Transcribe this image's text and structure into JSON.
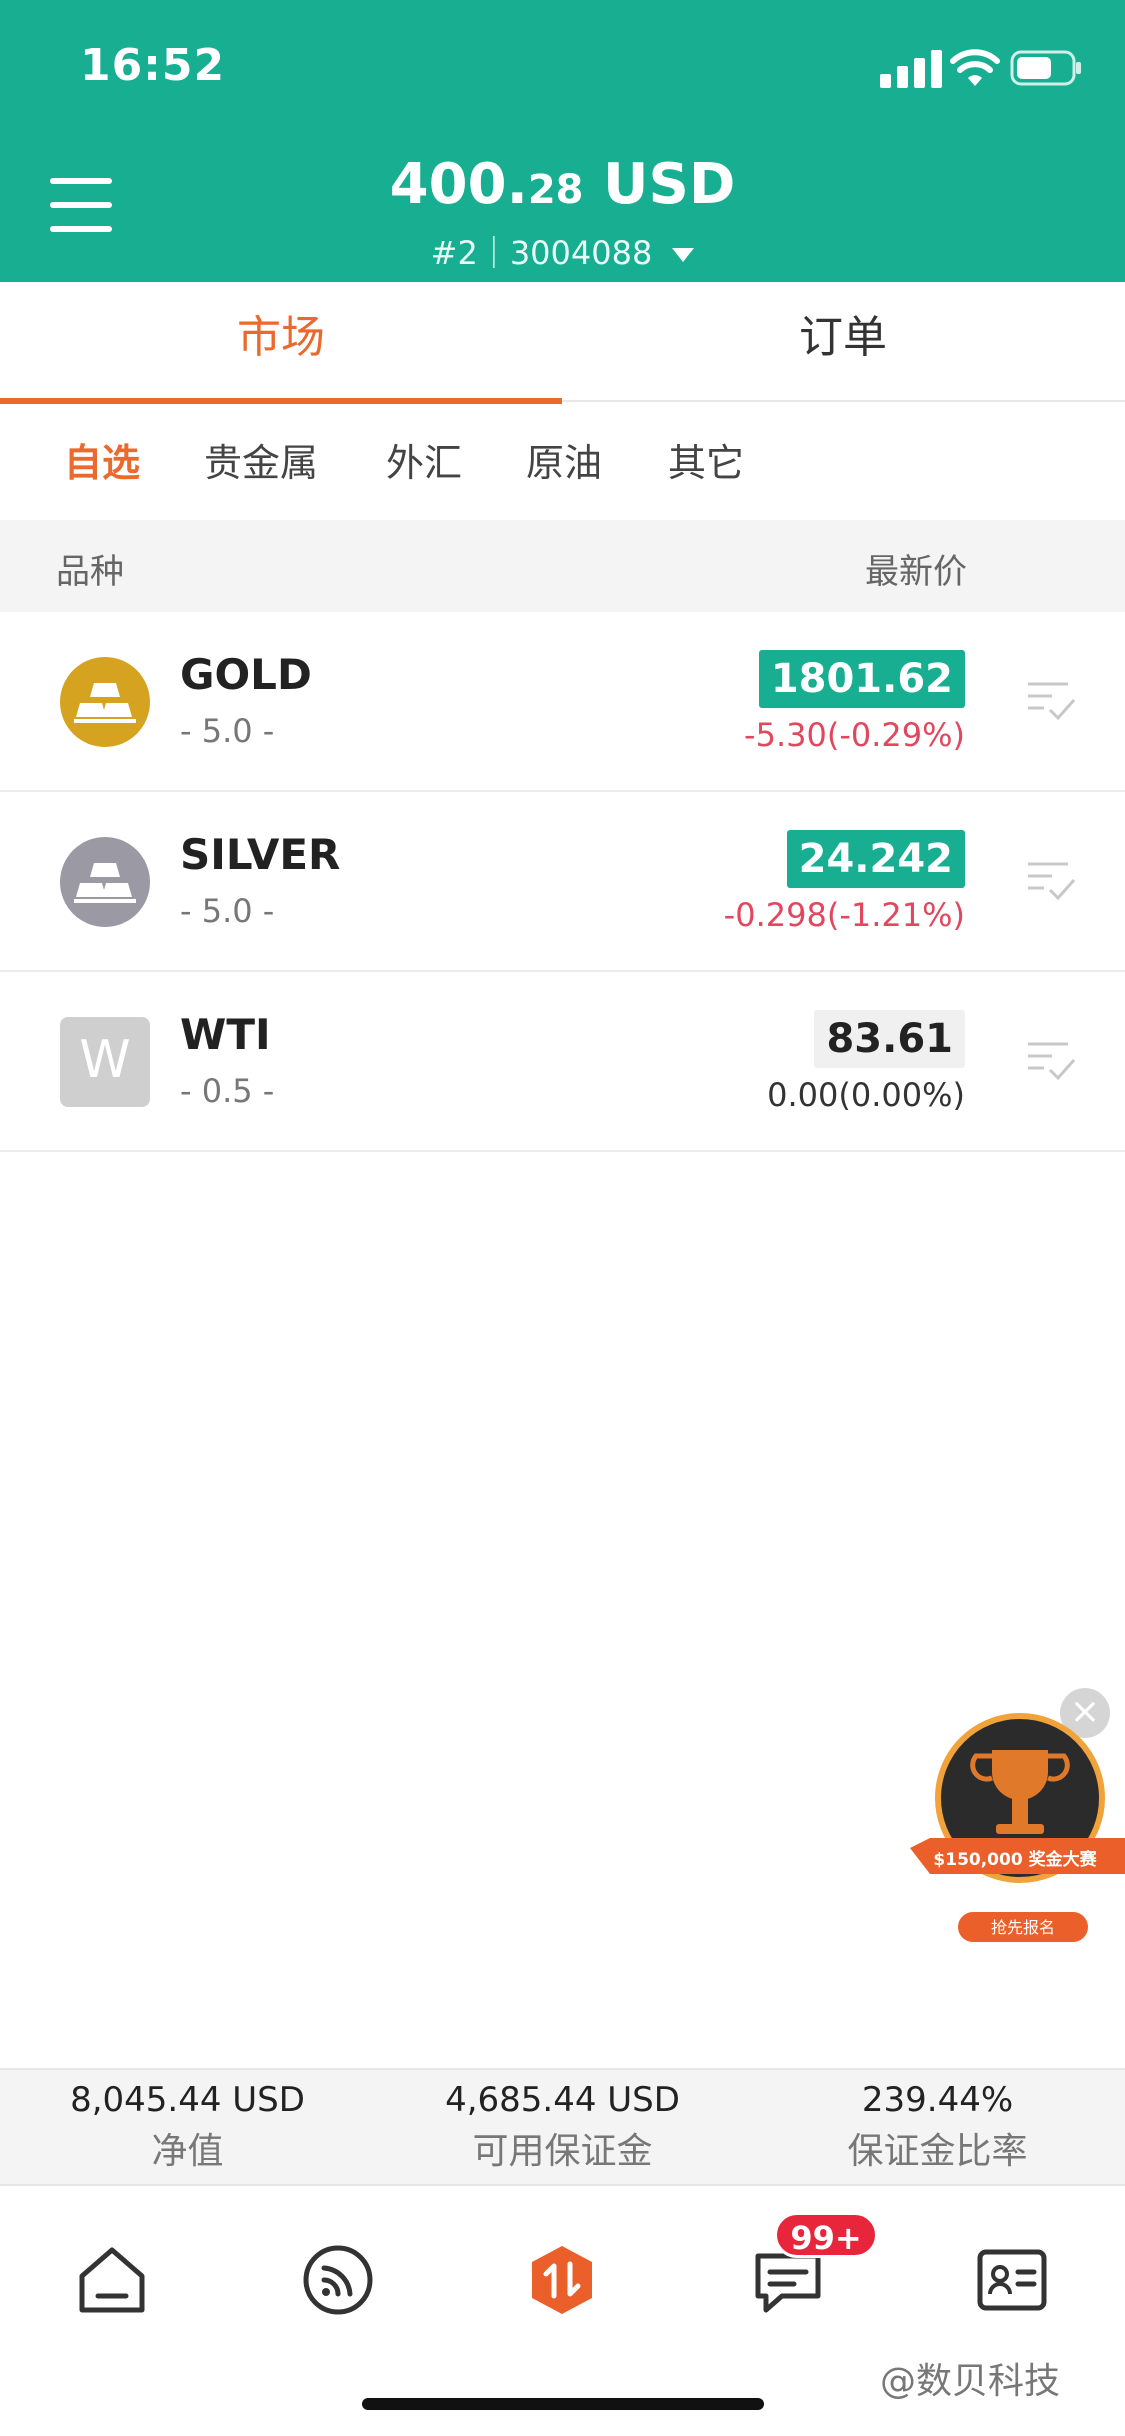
{
  "status_bar": {
    "time": "16:52"
  },
  "header": {
    "balance_int": "400.",
    "balance_dec": "28",
    "currency": "USD",
    "account": "#2｜3004088"
  },
  "main_tabs": [
    {
      "label": "市场",
      "active": true
    },
    {
      "label": "订单",
      "active": false
    }
  ],
  "sub_tabs": [
    {
      "label": "自选",
      "active": true
    },
    {
      "label": "贵金属"
    },
    {
      "label": "外汇"
    },
    {
      "label": "原油"
    },
    {
      "label": "其它"
    }
  ],
  "columns": {
    "symbol": "品种",
    "price": "最新价"
  },
  "instruments": [
    {
      "symbol": "GOLD",
      "lot": "- 5.0 -",
      "price": "1801.62",
      "change": "-5.30(-0.29%)",
      "icon": "gold-bars-icon"
    },
    {
      "symbol": "SILVER",
      "lot": "- 5.0 -",
      "price": "24.242",
      "change": "-0.298(-1.21%)",
      "icon": "silver-bars-icon"
    },
    {
      "symbol": "WTI",
      "lot": "- 0.5 -",
      "price": "83.61",
      "change": "0.00(0.00%)",
      "icon_letter": "W"
    }
  ],
  "promo": {
    "amount": "$150,000 奖金大赛",
    "cta": "抢先报名"
  },
  "summary": [
    {
      "value": "8,045.44 USD",
      "label": "净值"
    },
    {
      "value": "4,685.44 USD",
      "label": "可用保证金"
    },
    {
      "value": "239.44%",
      "label": "保证金比率"
    }
  ],
  "nav": {
    "items": [
      "home-icon",
      "news-feed-icon",
      "trade-icon",
      "messages-icon",
      "profile-card-icon"
    ],
    "badge": "99+"
  },
  "watermark": "@数贝科技",
  "colors": {
    "brand": "#17ae91",
    "accent": "#ea6a2e",
    "down": "#e2475e"
  }
}
